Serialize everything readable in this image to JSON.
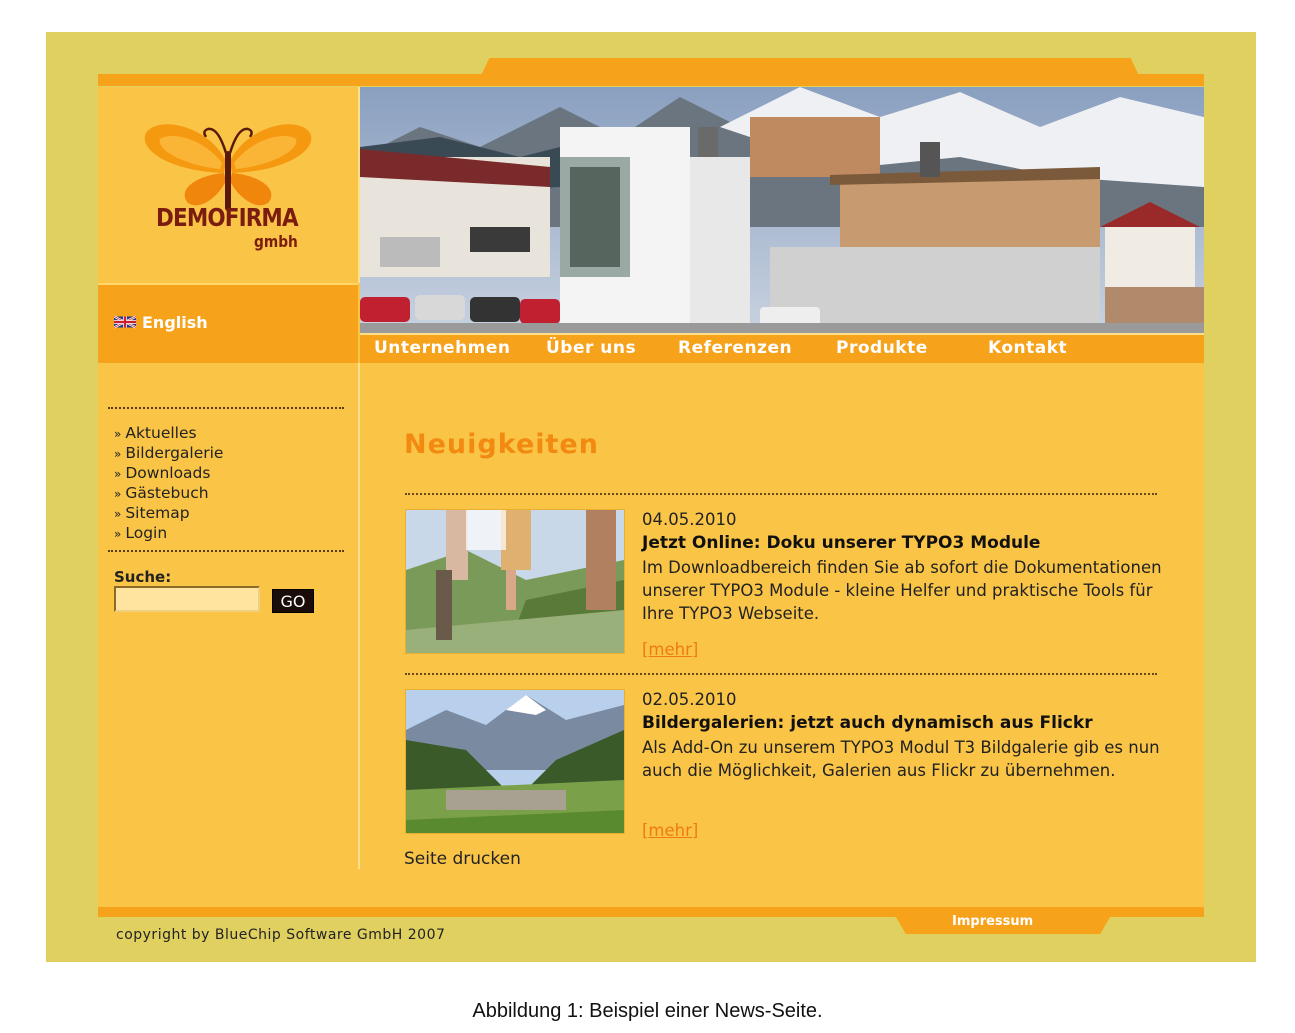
{
  "brand": {
    "logo_name": "DEMOFIRMA",
    "logo_sub": "gmbh"
  },
  "language": {
    "label": "English",
    "flag_icon": "uk-flag-icon"
  },
  "nav": {
    "items": [
      "Unternehmen",
      "Über uns",
      "Referenzen",
      "Produkte",
      "Kontakt"
    ]
  },
  "sidebar": {
    "menu": [
      "Aktuelles",
      "Bildergalerie",
      "Downloads",
      "Gästebuch",
      "Sitemap",
      "Login"
    ],
    "bullet": "»",
    "search_label": "Suche:",
    "search_value": "",
    "search_button": "GO"
  },
  "content": {
    "title": "Neuigkeiten",
    "news": [
      {
        "date": "04.05.2010",
        "title": "Jetzt Online: Doku unserer TYPO3 Module",
        "text": "Im Downloadbereich finden Sie ab sofort die Dokumentationen unserer TYPO3 Module - kleine Helfer und praktische Tools für Ihre TYPO3 Webseite.",
        "more": "[mehr]"
      },
      {
        "date": "02.05.2010",
        "title": "Bildergalerien: jetzt auch dynamisch aus Flickr",
        "text": "Als Add-On zu unserem TYPO3 Modul T3 Bildgalerie gib es nun auch die Möglichkeit, Galerien aus Flickr zu übernehmen.",
        "more": "[mehr]"
      }
    ],
    "print_link": "Seite drucken"
  },
  "footer": {
    "impressum": "Impressum",
    "copyright": "copyright by BlueChip Software GmbH 2007"
  },
  "caption": "Abbildung 1: Beispiel einer News-Seite.",
  "colors": {
    "frame": "#e0d060",
    "page": "#fac547",
    "accent": "#f7a21b",
    "title": "#f28a12",
    "logo": "#7a1d10"
  }
}
